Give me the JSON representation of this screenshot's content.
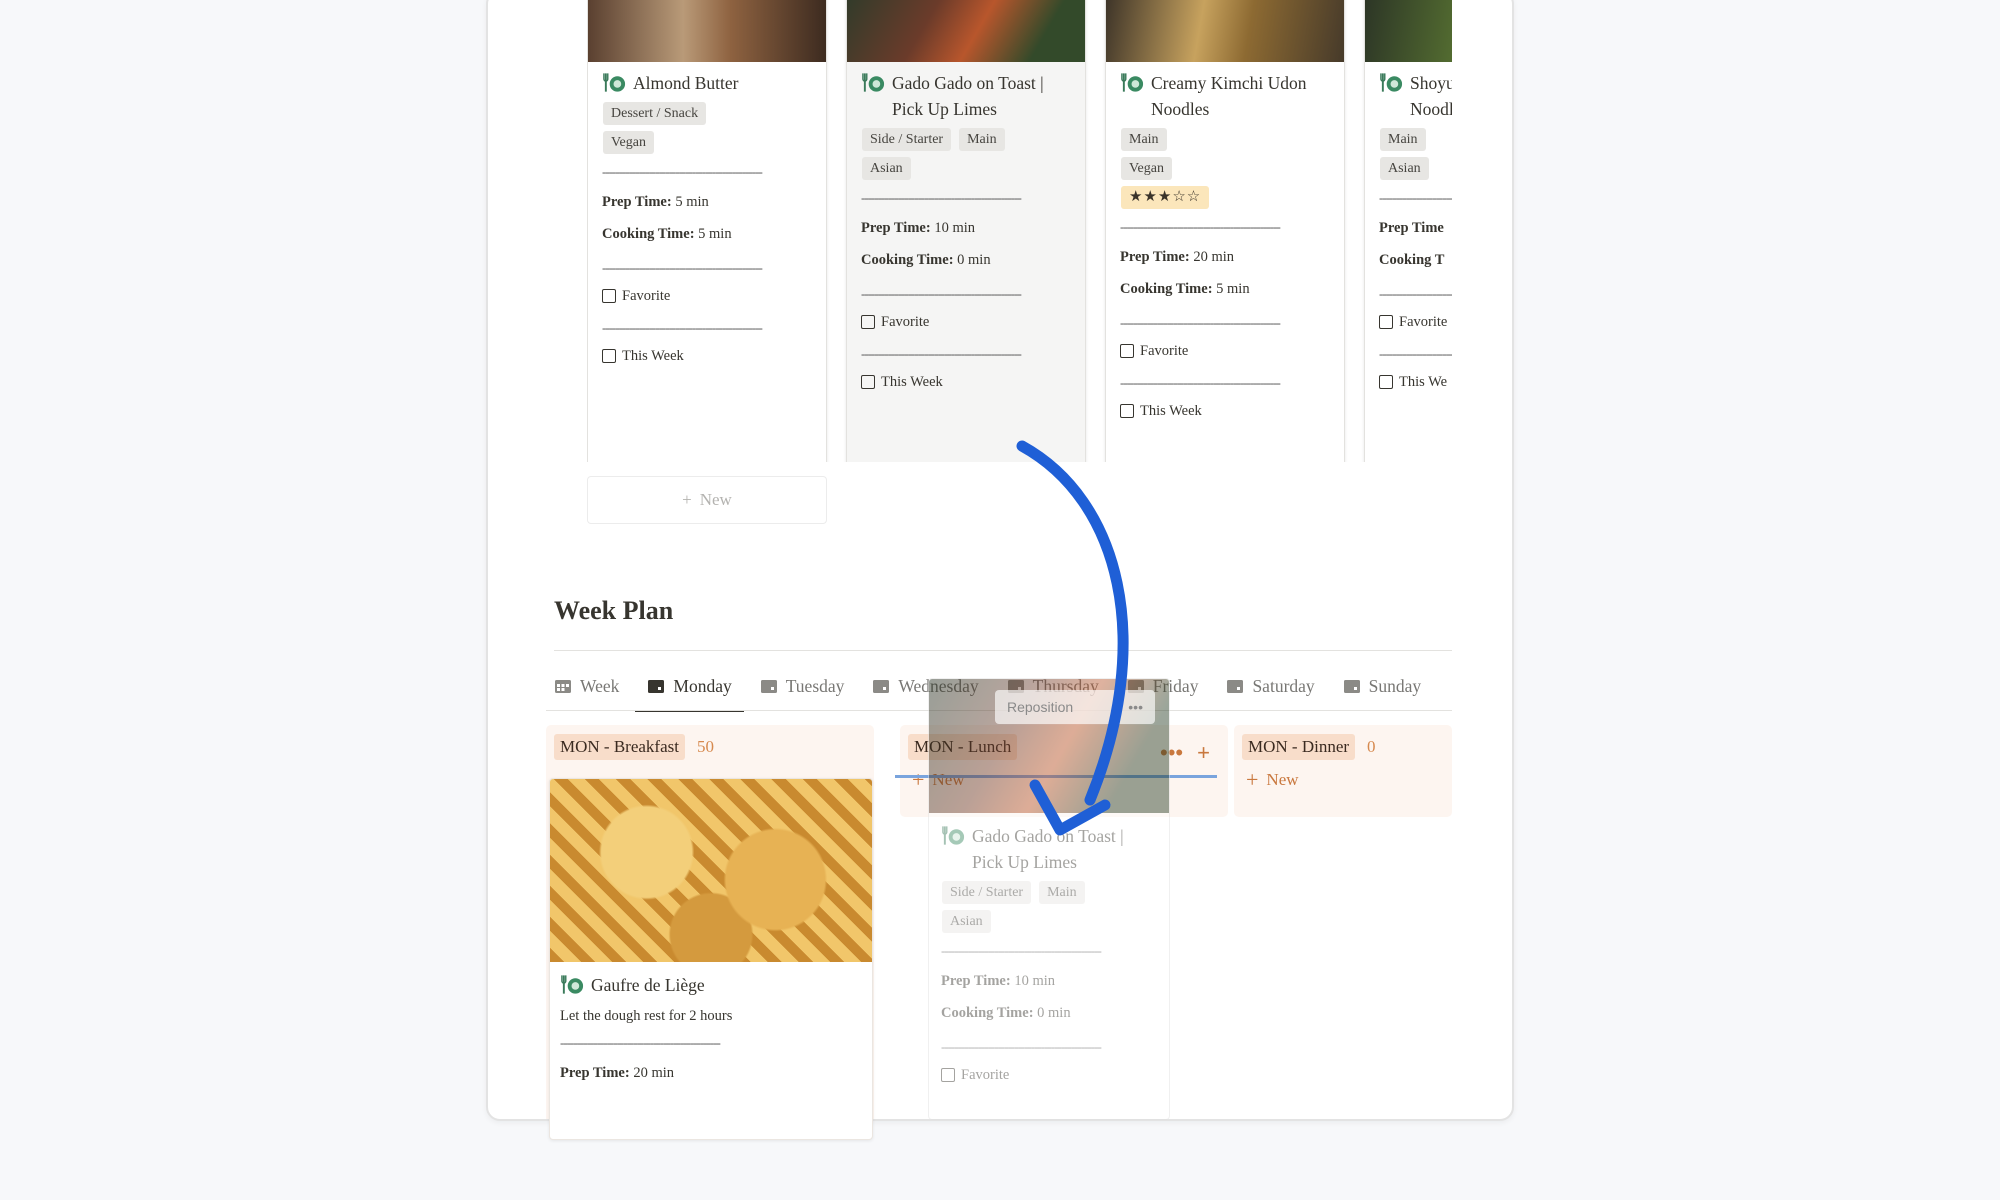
{
  "gallery": {
    "cards": [
      {
        "title_lines": [
          "Almond Butter"
        ],
        "tags": [
          [
            "Dessert / Snack"
          ],
          [
            "Vegan"
          ]
        ],
        "rating": "",
        "prep_label": "Prep Time:",
        "prep_value": "5 min",
        "cook_label": "Cooking Time:",
        "cook_value": "5 min",
        "favorite_label": "Favorite",
        "this_week_label": "This Week"
      },
      {
        "title_lines": [
          "Gado Gado on Toast |",
          "Pick Up Limes"
        ],
        "tags": [
          [
            "Side / Starter",
            "Main"
          ],
          [
            "Asian"
          ]
        ],
        "rating": "",
        "prep_label": "Prep Time:",
        "prep_value": "10 min",
        "cook_label": "Cooking Time:",
        "cook_value": "0 min",
        "favorite_label": "Favorite",
        "this_week_label": "This Week"
      },
      {
        "title_lines": [
          "Creamy Kimchi Udon",
          "Noodles"
        ],
        "tags": [
          [
            "Main"
          ],
          [
            "Vegan"
          ]
        ],
        "rating": "★★★☆☆",
        "prep_label": "Prep Time:",
        "prep_value": "20 min",
        "cook_label": "Cooking Time:",
        "cook_value": "5 min",
        "favorite_label": "Favorite",
        "this_week_label": "This Week"
      },
      {
        "title_lines": [
          "Shoyu",
          "Noodl"
        ],
        "tags": [
          [
            "Main"
          ],
          [
            "Asian"
          ]
        ],
        "rating": "",
        "prep_label": "Prep Time",
        "prep_value": "",
        "cook_label": "Cooking T",
        "cook_value": "",
        "favorite_label": "Favorite",
        "this_week_label": "This We"
      }
    ],
    "separator": "------------------------------------------------",
    "new_label": "New"
  },
  "week_plan": {
    "title": "Week Plan",
    "tabs": [
      "Week",
      "Monday",
      "Tuesday",
      "Wednesday",
      "Thursday",
      "Friday",
      "Saturday",
      "Sunday"
    ],
    "active_tab": "Monday",
    "columns": [
      {
        "label": "MON - Breakfast",
        "count": "50"
      },
      {
        "label": "MON - Lunch",
        "count": ""
      },
      {
        "label": "MON - Dinner",
        "count": "0"
      }
    ],
    "new_label": "New",
    "breakfast_card": {
      "title": "Gaufre de Liège",
      "note": "Let the dough rest for 2 hours",
      "prep_label": "Prep Time:",
      "prep_value": "20 min"
    },
    "dragging_card": {
      "reposition_label": "Reposition",
      "more_label": "•••",
      "title_lines": [
        "Gado Gado on Toast |",
        "Pick Up Limes"
      ],
      "tags": [
        [
          "Side / Starter",
          "Main"
        ],
        [
          "Asian"
        ]
      ],
      "prep_label": "Prep Time:",
      "prep_value": "10 min",
      "cook_label": "Cooking Time:",
      "cook_value": "0 min",
      "favorite_label": "Favorite"
    },
    "lunch_actions": {
      "more": "•••",
      "add": "+"
    }
  },
  "colors": {
    "accent_orange": "#c9783e",
    "group_tag_bg": "#f8ddca",
    "arrow_blue": "#1f5fd6",
    "drop_indicator": "#7aa4dd"
  }
}
